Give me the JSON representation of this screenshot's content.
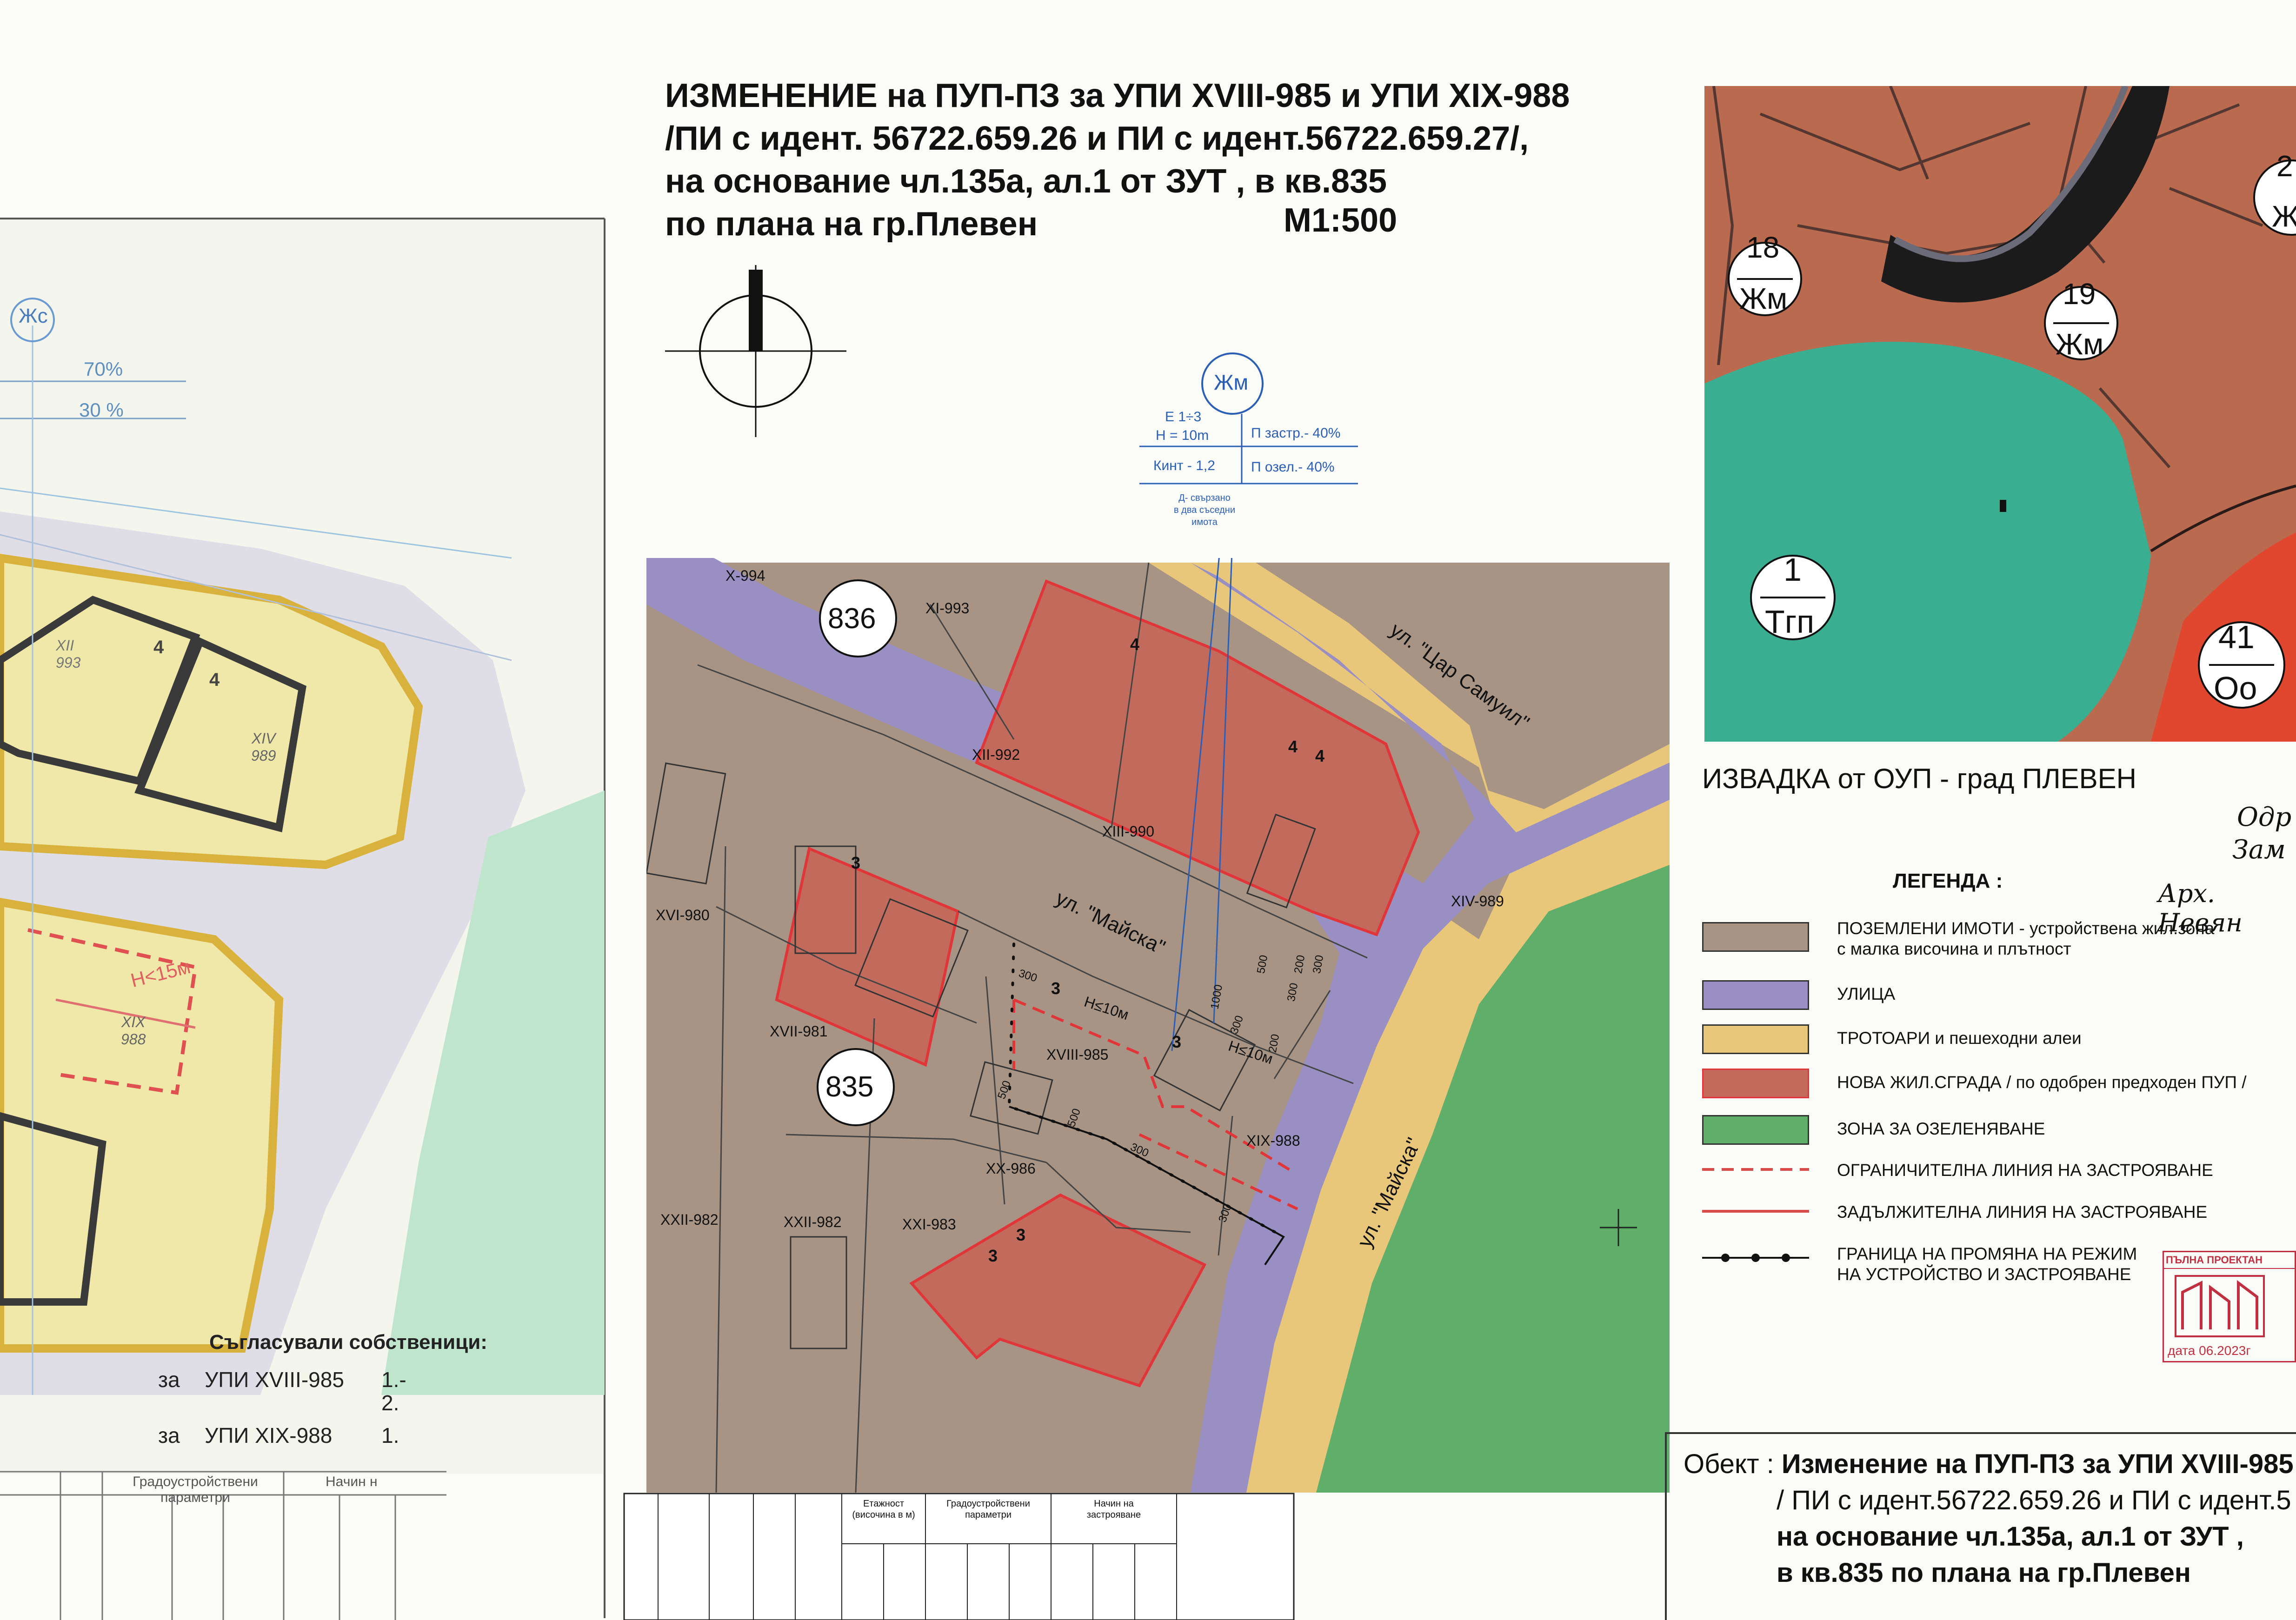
{
  "title": {
    "line1": "ИЗМЕНЕНИЕ  на  ПУП-ПЗ за  УПИ XVIII-985 и УПИ XIX-988",
    "line2": "/ПИ с идент. 56722.659.26 и ПИ с идент.56722.659.27/,",
    "line3": "на основание чл.135а, ал.1 от ЗУТ , в кв.835",
    "line4": "по плана на гр.Плевен",
    "scale": "М1:500"
  },
  "zone_box": {
    "zone": "Жм",
    "floors": "Е 1÷3",
    "height": "Н = 10m",
    "density": "П застр.- 40%",
    "kint": "Кинт - 1,2",
    "green": "П озел.- 40%",
    "note": "Д- свързано\nв два съседни\nимота"
  },
  "map_labels": {
    "block_836": "836",
    "block_835": "835",
    "street_tsar": "ул. \"Цар Самуил\"",
    "street_maiska1": "ул. \"Майска\"",
    "street_maiska2": "ул. \"Майска\"",
    "plots": [
      "X-994",
      "XI-993",
      "XII-992",
      "XIII-990",
      "XIV-989",
      "XVI-980",
      "XVII-981",
      "XVIII-985",
      "XIX-988",
      "XX-986",
      "XXI-983",
      "XXII-982",
      "XXII-982"
    ],
    "floors": [
      "4",
      "4",
      "4",
      "3",
      "3",
      "3",
      "3",
      "3"
    ],
    "heights": [
      "Н≤10м",
      "Н≤10м"
    ],
    "dims": [
      "300",
      "300",
      "500",
      "500",
      "300",
      "300",
      "1000",
      "300",
      "500",
      "200",
      "200",
      "300"
    ]
  },
  "ovp": {
    "caption": "ИЗВАДКА от ОУП - град ПЛЕВЕН",
    "zones": [
      {
        "num": "18",
        "code": "Жм"
      },
      {
        "num": "19",
        "code": "Жм"
      },
      {
        "num": "1",
        "code": "Тгп"
      },
      {
        "num": "41",
        "code": "Оо"
      },
      {
        "num": "2",
        "code": "Ж"
      }
    ]
  },
  "legend": {
    "title": "ЛЕГЕНДА :",
    "items": [
      {
        "text": "ПОЗЕМЛЕНИ ИМОТИ - устройствена жил.зона\nс малка височина и плътност",
        "color": "#a89484"
      },
      {
        "text": "УЛИЦА",
        "color": "#9a8fc2"
      },
      {
        "text": "ТРОТОАРИ и пешеходни алеи",
        "color": "#e9c77a"
      },
      {
        "text": "НОВА ЖИЛ.СГРАДА / по одобрен предходен ПУП /",
        "color": "#c26b5c"
      },
      {
        "text": "ЗОНА ЗА ОЗЕЛЕНЯВАНЕ",
        "color": "#5fae69"
      },
      {
        "text": "ОГРАНИЧИТЕЛНА ЛИНИЯ НА ЗАСТРОЯВАНЕ",
        "color": "#d94a4a"
      },
      {
        "text": "ЗАДЪЛЖИТЕЛНА ЛИНИЯ  НА ЗАСТРОЯВАНЕ",
        "color": "#d94a4a"
      },
      {
        "text": "ГРАНИЦА НА ПРОМЯНА НА РЕЖИМ\nНА УСТРОЙСТВО И ЗАСТРОЯВАНЕ",
        "color": "#111111"
      }
    ]
  },
  "handwritten": {
    "line1": "Одр",
    "line2": "Зам",
    "line3": "Арх. Невян"
  },
  "stamp": {
    "header": "ПЪЛНА ПРОЕКТАН",
    "date": "дата 06.2023г"
  },
  "object": {
    "label": "Обект :",
    "line1": "Изменение на ПУП-ПЗ за УПИ XVIII-985",
    "line2": "/ ПИ с идент.56722.659.26 и ПИ с идент.5",
    "line3": "на основание чл.135а, ал.1 от ЗУТ ,",
    "line4": "в кв.835 по плана на гр.Плевен"
  },
  "owners": {
    "title": "Съгласували собственици:",
    "row1_label": "за",
    "row1_value": "УПИ XVIII-985",
    "row1_num": "1.-",
    "row1_num2": "2.",
    "row2_label": "за",
    "row2_value": "УПИ XIX-988",
    "row2_num": "1."
  },
  "old_plan": {
    "zone": "Жс",
    "pct1": "70%",
    "pct2": "30 %",
    "floor_a": "4",
    "floor_b": "4",
    "plot_a": "XIV\n989",
    "plot_b": "XIX\n988",
    "plot_c": "XII\n993",
    "h_label": "Н<15м",
    "hdr_param": "Градоустройствени\nпараметри",
    "hdr_way": "Начин н"
  },
  "table": {
    "etaj": "Етажност\n(височина в м)",
    "grad": "Градоустройствени\nпараметри",
    "nachin": "Начин на\nзастрояване"
  }
}
